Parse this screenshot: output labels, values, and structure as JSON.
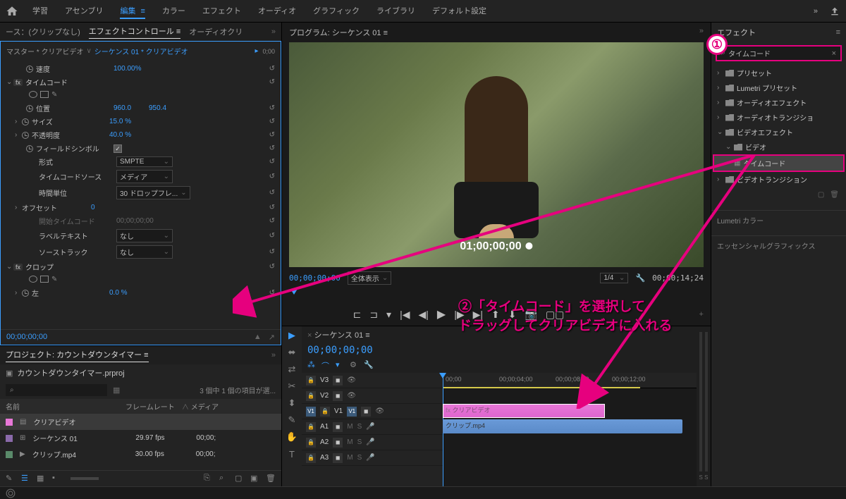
{
  "topbar": {
    "workspaces": [
      "学習",
      "アセンブリ",
      "編集",
      "カラー",
      "エフェクト",
      "オーディオ",
      "グラフィック",
      "ライブラリ",
      "デフォルト設定"
    ],
    "active_workspace": "編集"
  },
  "source_panel": {
    "tab_source": "ース：(クリップなし)",
    "tab_effect_controls": "エフェクトコントロール",
    "tab_audio": "オーディオクリ"
  },
  "effect_controls": {
    "master_label": "マスター * クリアビデオ",
    "sequence_label": "シーケンス 01 * クリアビデオ",
    "speed_label": "速度",
    "speed_value": "100.00%",
    "timecode_fx": "タイムコード",
    "position_label": "位置",
    "position_x": "960.0",
    "position_y": "950.4",
    "size_label": "サイズ",
    "size_value": "15.0 %",
    "opacity_label": "不透明度",
    "opacity_value": "40.0 %",
    "field_symbol_label": "フィールドシンボル",
    "format_label": "形式",
    "format_value": "SMPTE",
    "tc_source_label": "タイムコードソース",
    "tc_source_value": "メディア",
    "time_unit_label": "時間単位",
    "time_unit_value": "30 ドロップフレ...",
    "offset_label": "オフセット",
    "offset_value": "0",
    "start_tc_label": "開始タイムコード",
    "start_tc_value": "00;00;00;00",
    "label_text_label": "ラベルテキスト",
    "label_text_value": "なし",
    "source_track_label": "ソーストラック",
    "source_track_value": "なし",
    "crop_fx": "クロップ",
    "left_label": "左",
    "left_value": "0.0 %",
    "footer_tc": "00;00;00;00"
  },
  "project": {
    "title": "プロジェクト: カウントダウンタイマー",
    "filename": "カウントダウンタイマー.prproj",
    "info": "3 個中 1 個の項目が選...",
    "col_name": "名前",
    "col_framerate": "フレームレート",
    "col_media": "メディア",
    "items": [
      {
        "name": "クリアビデオ",
        "fps": "",
        "media": "",
        "color": "#e878d8",
        "selected": true
      },
      {
        "name": "シーケンス 01",
        "fps": "29.97 fps",
        "media": "00;00;",
        "color": "#8a6aaa"
      },
      {
        "name": "クリップ.mp4",
        "fps": "30.00 fps",
        "media": "00;00;",
        "color": "#5a8a6a"
      }
    ]
  },
  "program": {
    "title": "プログラム: シーケンス 01",
    "overlay_tc": "01;00;00;00",
    "current_tc": "00;00;00;00",
    "fit_label": "全体表示",
    "zoom": "1/4",
    "duration_tc": "00;00;14;24"
  },
  "timeline": {
    "title": "シーケンス 01",
    "current_tc": "00;00;00;00",
    "ruler_ticks": [
      "00;00",
      "00;00;04;00",
      "00;00;08;00",
      "00;00;12;00"
    ],
    "video_tracks": [
      "V3",
      "V2",
      "V1"
    ],
    "audio_tracks": [
      "A1",
      "A2",
      "A3"
    ],
    "clip_clear": "クリアビデオ",
    "clip_video": "クリップ.mp4",
    "meter_label": "S  S"
  },
  "effects": {
    "title": "エフェクト",
    "search_value": "タイムコード",
    "presets": "プリセット",
    "lumetri_presets": "Lumetri プリセット",
    "audio_effects": "オーディオエフェクト",
    "audio_transitions": "オーディオトランジショ",
    "video_effects": "ビデオエフェクト",
    "video_folder": "ビデオ",
    "timecode_effect": "タイムコード",
    "video_transitions": "ビデオトランジション",
    "lumetri_color": "Lumetri カラー",
    "essential_graphics": "エッセンシャルグラフィックス"
  },
  "annotations": {
    "num1": "①",
    "num2": "②",
    "text_line1": "「タイムコード」を選択して",
    "text_line2": "ドラッグしてクリアビデオに入れる"
  }
}
